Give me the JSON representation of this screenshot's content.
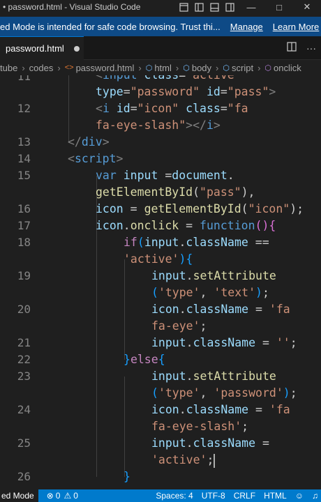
{
  "window": {
    "title": "• password.html - Visual Studio Code",
    "buttons": [
      "layout-icon",
      "sidebar-icon",
      "panel-icon",
      "split-icon"
    ],
    "controls": [
      "—",
      "□",
      "✕"
    ]
  },
  "banner": {
    "message": "ed Mode is intended for safe code browsing. Trust thi...",
    "manage": "Manage",
    "learn_more": "Learn More"
  },
  "tab": {
    "label": "password.html"
  },
  "breadcrumb": {
    "items": [
      "tube",
      "codes",
      "password.html",
      "html",
      "body",
      "script",
      "onclick"
    ]
  },
  "editor": {
    "line_numbers": [
      "11",
      "12",
      "13",
      "14",
      "15",
      "16",
      "17",
      "18",
      "19",
      "20",
      "21",
      "22",
      "23",
      "24",
      "25",
      "26"
    ]
  },
  "status": {
    "mode": "ed Mode",
    "errors": "0",
    "warnings": "0",
    "spaces": "Spaces: 4",
    "encoding": "UTF-8",
    "eol": "CRLF",
    "language": "HTML"
  },
  "colors": {
    "accent": "#007acc",
    "banner": "#0e4a86"
  }
}
